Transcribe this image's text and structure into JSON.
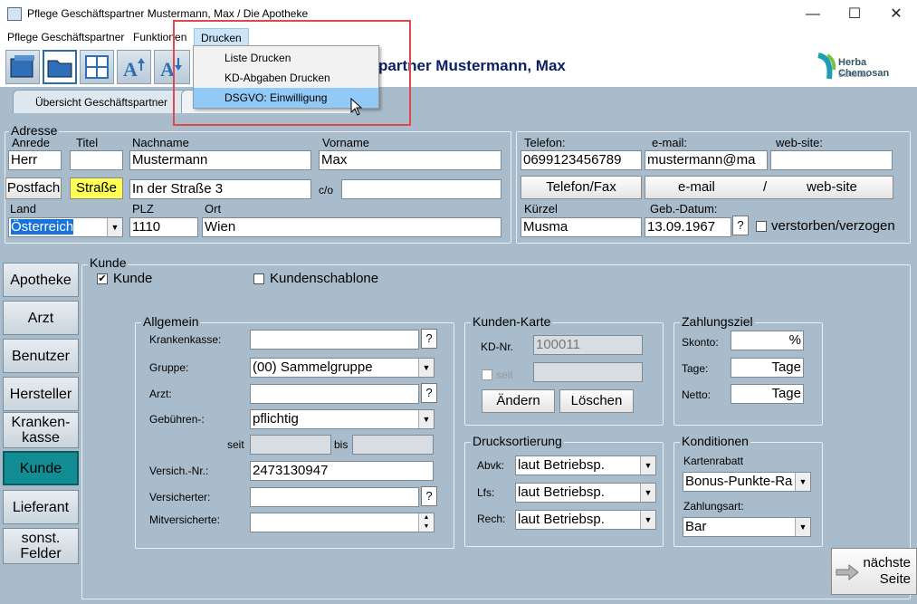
{
  "window": {
    "title": "Pflege Geschäftspartner Mustermann, Max / Die Apotheke",
    "minimize": "—",
    "maximize": "☐",
    "close": "✕"
  },
  "menu": {
    "items": [
      "Pflege Geschäftspartner",
      "Funktionen",
      "Drucken"
    ]
  },
  "dropdown": {
    "items": [
      "Liste Drucken",
      "KD-Abgaben Drucken",
      "DSGVO: Einwilligung"
    ]
  },
  "header": {
    "title": "partner Mustermann, Max",
    "logo_name": "Herba Chemosan",
    "logo_sub": "Sanodat"
  },
  "tabs": [
    "Übersicht Geschäftspartner"
  ],
  "address": {
    "group_label": "Adresse",
    "labels": {
      "anrede": "Anrede",
      "titel": "Titel",
      "nachname": "Nachname",
      "vorname": "Vorname",
      "land": "Land",
      "plz": "PLZ",
      "ort": "Ort",
      "co": "c/o"
    },
    "anrede": "Herr",
    "titel": "",
    "nachname": "Mustermann",
    "vorname": "Max",
    "postfach_button": "Postfach",
    "strasse_button": "Straße",
    "strasse": "In der Straße 3",
    "co": "",
    "land": "Österreich",
    "plz": "1110",
    "ort": "Wien"
  },
  "contact": {
    "labels": {
      "telefon": "Telefon:",
      "email": "e-mail:",
      "website": "web-site:",
      "kuerzel": "Kürzel",
      "geb": "Geb.-Datum:"
    },
    "telefon": "0699123456789",
    "email": "mustermann@ma",
    "website": "",
    "telefon_button": "Telefon/Fax",
    "email_button": "e-mail",
    "slash": "/",
    "website_button": "web-site",
    "kuerzel": "Musma",
    "geb": "13.09.1967",
    "geb_help": "?",
    "verstorben_label": "verstorben/verzogen"
  },
  "nav": [
    "Apotheke",
    "Arzt",
    "Benutzer",
    "Hersteller",
    "Kranken-\nkasse",
    "Kunde",
    "Lieferant",
    "sonst.\nFelder"
  ],
  "kunde": {
    "group_label": "Kunde",
    "kunde_check": "Kunde",
    "kunde_checked": "✔",
    "schablone_check": "Kundenschablone"
  },
  "allgemein": {
    "group_label": "Allgemein",
    "labels": {
      "krankenkasse": "Krankenkasse:",
      "gruppe": "Gruppe:",
      "arzt": "Arzt:",
      "gebuehren": "Gebühren-:",
      "seit": "seit",
      "bis": "bis",
      "versich_nr": "Versich.-Nr.:",
      "versicherter": "Versicherter:",
      "mitversicherte": "Mitversicherte:"
    },
    "krankenkasse": "",
    "gruppe": "(00) Sammelgruppe",
    "arzt": "",
    "gebuehren": "pflichtig",
    "seit": "",
    "bis": "",
    "versich_nr": "2473130947",
    "versicherter": "",
    "mitversicherte": "",
    "help": "?"
  },
  "kundenkarte": {
    "group_label": "Kunden-Karte",
    "kd_nr_label": "KD-Nr.",
    "kd_nr": "100011",
    "seit_label": "seit",
    "seit": "",
    "aendern": "Ändern",
    "loeschen": "Löschen"
  },
  "zahlungsziel": {
    "group_label": "Zahlungsziel",
    "skonto_label": "Skonto:",
    "skonto": "%",
    "tage_label": "Tage:",
    "tage": "Tage",
    "netto_label": "Netto:",
    "netto": "Tage"
  },
  "drucksortierung": {
    "group_label": "Drucksortierung",
    "abvk_label": "Abvk:",
    "abvk": "laut Betriebsp.",
    "lfs_label": "Lfs:",
    "lfs": "laut Betriebsp.",
    "rech_label": "Rech:",
    "rech": "laut Betriebsp."
  },
  "konditionen": {
    "group_label": "Konditionen",
    "kartenrabatt_label": "Kartenrabatt",
    "kartenrabatt": "Bonus-Punkte-Ra",
    "zahlungsart_label": "Zahlungsart:",
    "zahlungsart": "Bar"
  },
  "next_button": {
    "line1": "nächste",
    "line2": "Seite"
  }
}
